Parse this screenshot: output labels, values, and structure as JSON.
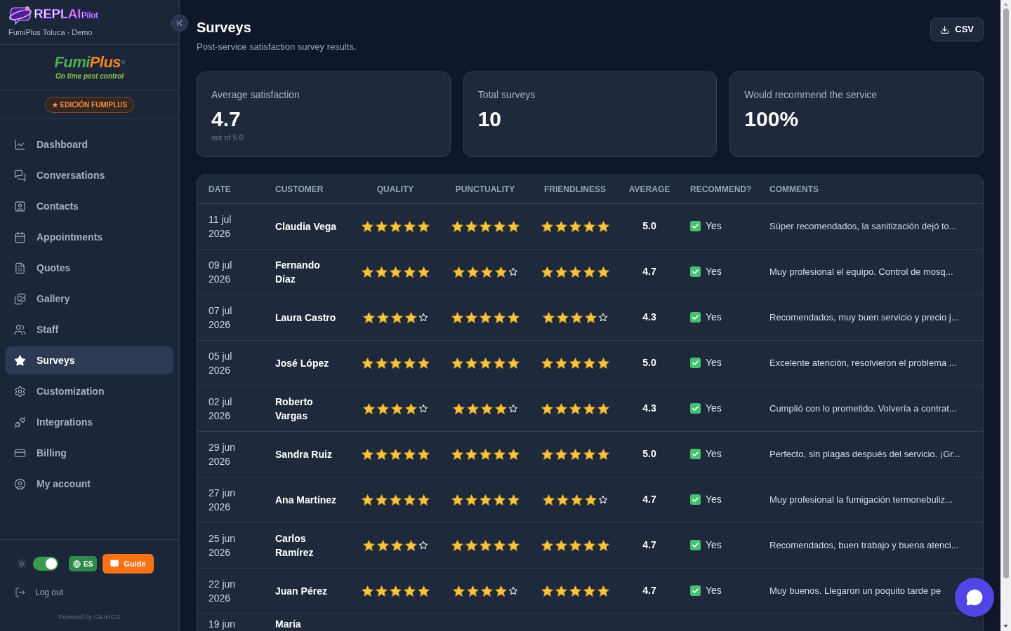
{
  "sidebar": {
    "brand": {
      "logo_main": "REPL",
      "logo_accent": "AI",
      "logo_suffix": "Pilot",
      "subtitle": "FumiPlus Toluca · Demo"
    },
    "client_logo": {
      "name_first": "Fumi",
      "name_second": "Plus",
      "mark": "®",
      "tagline": "On time pest control"
    },
    "edition_badge": "★ EDICIÓN FUMIPLUS",
    "nav": [
      {
        "label": "Dashboard",
        "selected": false
      },
      {
        "label": "Conversations",
        "selected": false
      },
      {
        "label": "Contacts",
        "selected": false
      },
      {
        "label": "Appointments",
        "selected": false
      },
      {
        "label": "Quotes",
        "selected": false
      },
      {
        "label": "Gallery",
        "selected": false
      },
      {
        "label": "Staff",
        "selected": false
      },
      {
        "label": "Surveys",
        "selected": true
      },
      {
        "label": "Customization",
        "selected": false
      },
      {
        "label": "Integrations",
        "selected": false
      },
      {
        "label": "Billing",
        "selected": false
      },
      {
        "label": "My account",
        "selected": false
      }
    ],
    "footer": {
      "theme_toggle": {
        "on": true
      },
      "language_button": "ES",
      "guide_button": "Guide",
      "logout": "Log out",
      "powered_by": "Powered by GlennGO"
    }
  },
  "header": {
    "title": "Surveys",
    "subtitle": "Post-service satisfaction survey results.",
    "export_button": "CSV"
  },
  "stats": [
    {
      "label": "Average satisfaction",
      "value": "4.7",
      "note": "out of 5.0"
    },
    {
      "label": "Total surveys",
      "value": "10"
    },
    {
      "label": "Would recommend the service",
      "value": "100%"
    }
  ],
  "table": {
    "columns": [
      "DATE",
      "CUSTOMER",
      "QUALITY",
      "PUNCTUALITY",
      "FRIENDLINESS",
      "AVERAGE",
      "RECOMMEND?",
      "COMMENTS"
    ],
    "rows": [
      {
        "kind": "complete",
        "date": "11 jul 2026",
        "customer": "Claudia Vega",
        "ratings": [
          {
            "stars": 5
          },
          {
            "stars": 5
          },
          {
            "stars": 5
          }
        ],
        "average": "5.0",
        "recommend": {
          "checked": true,
          "label": "Yes"
        },
        "comment": "Súper recomendados, la sanitización dejó to..."
      },
      {
        "kind": "complete",
        "date": "09 jul 2026",
        "customer": "Fernando Díaz",
        "ratings": [
          {
            "stars": 5
          },
          {
            "stars": 4
          },
          {
            "stars": 5
          }
        ],
        "average": "4.7",
        "recommend": {
          "checked": true,
          "label": "Yes"
        },
        "comment": "Muy profesional el equipo. Control de mosq..."
      },
      {
        "kind": "complete",
        "date": "07 jul 2026",
        "customer": "Laura Castro",
        "ratings": [
          {
            "stars": 4
          },
          {
            "stars": 5
          },
          {
            "stars": 4
          }
        ],
        "average": "4.3",
        "recommend": {
          "checked": true,
          "label": "Yes"
        },
        "comment": "Recomendados, muy buen servicio y precio j..."
      },
      {
        "kind": "complete",
        "date": "05 jul 2026",
        "customer": "José López",
        "ratings": [
          {
            "stars": 5
          },
          {
            "stars": 5
          },
          {
            "stars": 5
          }
        ],
        "average": "5.0",
        "recommend": {
          "checked": true,
          "label": "Yes"
        },
        "comment": "Excelente atención, resolvieron el problema ..."
      },
      {
        "kind": "complete",
        "date": "02 jul 2026",
        "customer": "Roberto Vargas",
        "ratings": [
          {
            "stars": 4
          },
          {
            "stars": 4
          },
          {
            "stars": 5
          }
        ],
        "average": "4.3",
        "recommend": {
          "checked": true,
          "label": "Yes"
        },
        "comment": "Cumplió con lo prometido. Volvería a contrat..."
      },
      {
        "kind": "complete",
        "date": "29 jun 2026",
        "customer": "Sandra Ruiz",
        "ratings": [
          {
            "stars": 5
          },
          {
            "stars": 5
          },
          {
            "stars": 5
          }
        ],
        "average": "5.0",
        "recommend": {
          "checked": true,
          "label": "Yes"
        },
        "comment": "Perfecto, sin plagas después del servicio. ¡Gr..."
      },
      {
        "kind": "complete",
        "date": "27 jun 2026",
        "customer": "Ana Martínez",
        "ratings": [
          {
            "stars": 5
          },
          {
            "stars": 5
          },
          {
            "stars": 4
          }
        ],
        "average": "4.7",
        "recommend": {
          "checked": true,
          "label": "Yes"
        },
        "comment": "Muy profesional la fumigación termonebuliz..."
      },
      {
        "kind": "complete",
        "date": "25 jun 2026",
        "customer": "Carlos Ramírez",
        "ratings": [
          {
            "stars": 4
          },
          {
            "stars": 5
          },
          {
            "stars": 5
          }
        ],
        "average": "4.7",
        "recommend": {
          "checked": true,
          "label": "Yes"
        },
        "comment": "Recomendados, buen trabajo y buena atenci..."
      },
      {
        "kind": "complete",
        "date": "22 jun 2026",
        "customer": "Juan Pérez",
        "ratings": [
          {
            "stars": 5
          },
          {
            "stars": 4
          },
          {
            "stars": 5
          }
        ],
        "average": "4.7",
        "recommend": {
          "checked": true,
          "label": "Yes"
        },
        "comment": "Muy buenos. Llegaron un poquito tarde pe"
      },
      {
        "kind": "partial",
        "date": "19 jun",
        "customer": "María"
      }
    ]
  }
}
